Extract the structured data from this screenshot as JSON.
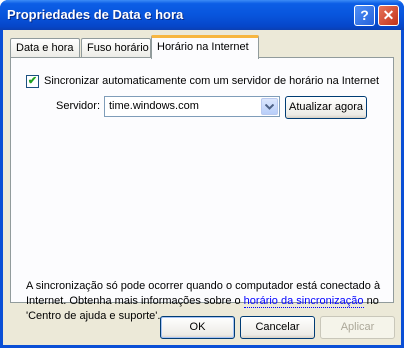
{
  "window": {
    "title": "Propriedades de Data e hora",
    "help_button": "?",
    "close_button": "✕"
  },
  "tabs": [
    {
      "label": "Data e hora"
    },
    {
      "label": "Fuso horário"
    },
    {
      "label": "Horário na Internet",
      "active": true
    }
  ],
  "internet_time": {
    "sync_checkbox_checked": true,
    "sync_checkbox_label": "Sincronizar automaticamente com um servidor de horário na Internet",
    "server_label": "Servidor:",
    "server_value": "time.windows.com",
    "update_button": "Atualizar agora",
    "info_text_1": "A sincronização só pode ocorrer quando o computador está conectado à Internet. Obtenha mais informações sobre o ",
    "info_link": "horário da sincronização",
    "info_text_2": " no 'Centro de ajuda e suporte'."
  },
  "footer": {
    "ok_label": "OK",
    "cancel_label": "Cancelar",
    "apply_label": "Aplicar"
  },
  "colors": {
    "titlebar_blue": "#0855dd",
    "dialog_face": "#ece9d8",
    "active_tab_accent": "#f7b640",
    "link": "#0000ff"
  }
}
